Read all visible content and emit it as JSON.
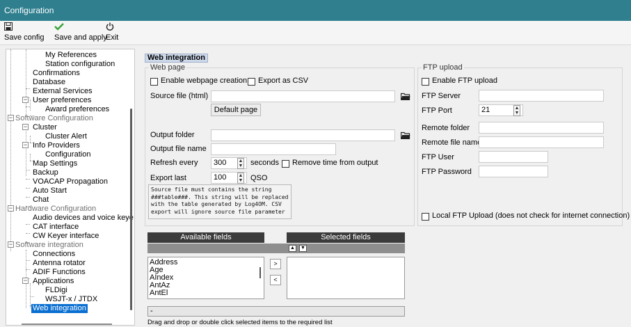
{
  "window": {
    "title": "Configuration"
  },
  "toolbar": {
    "save_config": "Save config",
    "save_and_apply": "Save and apply",
    "exit": "Exit"
  },
  "tree": {
    "items": [
      {
        "label": "My References",
        "kind": "leaf"
      },
      {
        "label": "Station configuration",
        "kind": "leaf"
      },
      {
        "label": "Confirmations",
        "kind": "leaf"
      },
      {
        "label": "Database",
        "kind": "leaf"
      },
      {
        "label": "External Services",
        "kind": "leaf"
      },
      {
        "label": "User preferences",
        "kind": "node"
      },
      {
        "label": "Award preferences",
        "kind": "leaf"
      },
      {
        "label": "Software Configuration",
        "kind": "category"
      },
      {
        "label": "Cluster",
        "kind": "node"
      },
      {
        "label": "Cluster Alert",
        "kind": "leaf"
      },
      {
        "label": "Info Providers",
        "kind": "node"
      },
      {
        "label": "Configuration",
        "kind": "leaf"
      },
      {
        "label": "Map Settings",
        "kind": "leaf"
      },
      {
        "label": "Backup",
        "kind": "leaf"
      },
      {
        "label": "VOACAP Propagation",
        "kind": "leaf"
      },
      {
        "label": "Auto Start",
        "kind": "leaf"
      },
      {
        "label": "Chat",
        "kind": "leaf"
      },
      {
        "label": "Hardware Configuration",
        "kind": "category"
      },
      {
        "label": "Audio devices and voice keye",
        "kind": "leaf"
      },
      {
        "label": "CAT interface",
        "kind": "leaf"
      },
      {
        "label": "CW Keyer interface",
        "kind": "leaf"
      },
      {
        "label": "Software integration",
        "kind": "category"
      },
      {
        "label": "Connections",
        "kind": "leaf"
      },
      {
        "label": "Antenna rotator",
        "kind": "leaf"
      },
      {
        "label": "ADIF Functions",
        "kind": "leaf"
      },
      {
        "label": "Applications",
        "kind": "node"
      },
      {
        "label": "FLDigi",
        "kind": "leaf"
      },
      {
        "label": "WSJT-x / JTDX",
        "kind": "leaf"
      },
      {
        "label": "Web integration",
        "kind": "leaf",
        "selected": true
      }
    ]
  },
  "panel": {
    "title": "Web integration",
    "web_page": {
      "group_label": "Web page",
      "enable_webpage_creation": "Enable webpage creation",
      "export_as_csv": "Export as CSV",
      "source_file_label": "Source file (html)",
      "source_file_value": "",
      "default_page_button": "Default page",
      "output_folder_label": "Output folder",
      "output_folder_value": "",
      "output_file_name_label": "Output file name",
      "output_file_name_value": "",
      "refresh_every_label": "Refresh every",
      "refresh_every_value": "300",
      "seconds_label": "seconds",
      "remove_time_label": "Remove time from output",
      "export_last_label": "Export last",
      "export_last_value": "100",
      "qso_label": "QSO",
      "note": "Source file must contains the string ###table###. This string will be replaced with the table generated by Log4OM. CSV export will ignore source file parameter"
    },
    "ftp": {
      "group_label": "FTP upload",
      "enable_ftp_upload": "Enable FTP upload",
      "ftp_server_label": "FTP Server",
      "ftp_server_value": "",
      "ftp_port_label": "FTP Port",
      "ftp_port_value": "21",
      "remote_folder_label": "Remote folder",
      "remote_folder_value": "",
      "remote_file_name_label": "Remote file name",
      "remote_file_name_value": "",
      "ftp_user_label": "FTP User",
      "ftp_user_value": "",
      "ftp_password_label": "FTP Password",
      "ftp_password_value": "",
      "local_ftp_upload": "Local FTP Upload (does not check for internet connection)"
    },
    "fields": {
      "available_header": "Available fields",
      "selected_header": "Selected fields",
      "available_items": [
        "Address",
        "Age",
        "AIndex",
        "AntAz",
        "AntEl"
      ],
      "selected_items": [],
      "move_right": ">",
      "move_left": "<",
      "status_value": "-",
      "hint": "Drag and drop or double click selected items to the required list"
    }
  },
  "colors": {
    "titlebar": "#2f7f8f",
    "selection": "#0a6fd1",
    "dark_header": "#3b3b3b"
  }
}
